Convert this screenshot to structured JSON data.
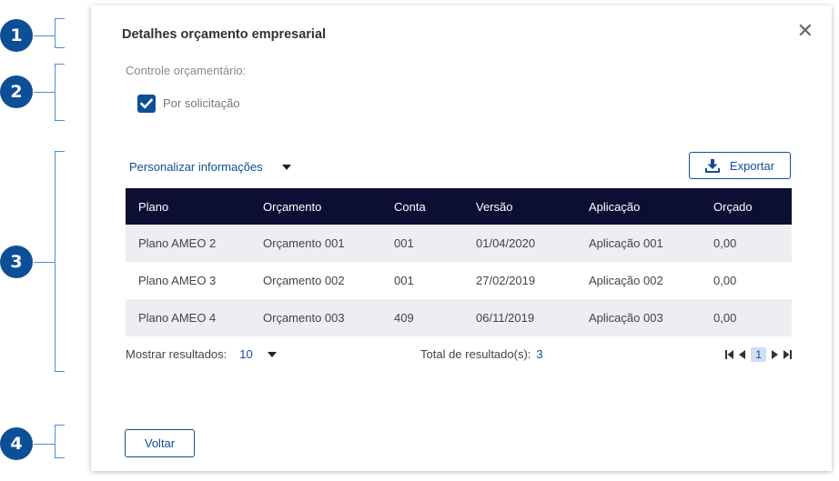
{
  "annotations": [
    "1",
    "2",
    "3",
    "4"
  ],
  "dialog": {
    "title": "Detalhes orçamento empresarial",
    "close_icon": "close-icon",
    "control_label": "Controle orçamentário:",
    "checkbox_label": "Por solicitação",
    "checkbox_checked": true,
    "customize_label": "Personalizar informações",
    "export_label": "Exportar",
    "export_icon": "download-icon",
    "back_label": "Voltar",
    "accent_color": "#0d4f96",
    "header_color": "#0c0f33"
  },
  "table": {
    "columns": [
      "Plano",
      "Orçamento",
      "Conta",
      "Versão",
      "Aplicação",
      "Orçado"
    ],
    "rows": [
      [
        "Plano AMEO 2",
        "Orçamento 001",
        "001",
        "01/04/2020",
        "Aplicação 001",
        "0,00"
      ],
      [
        "Plano AMEO 3",
        "Orçamento 002",
        "001",
        "27/02/2019",
        "Aplicação 002",
        "0,00"
      ],
      [
        "Plano AMEO 4",
        "Orçamento 003",
        "409",
        "06/11/2019",
        "Aplicação 003",
        "0,00"
      ]
    ]
  },
  "footer": {
    "show_label": "Mostrar resultados:",
    "show_value": "10",
    "total_label": "Total de resultado(s):",
    "total_value": "3",
    "current_page": "1"
  }
}
